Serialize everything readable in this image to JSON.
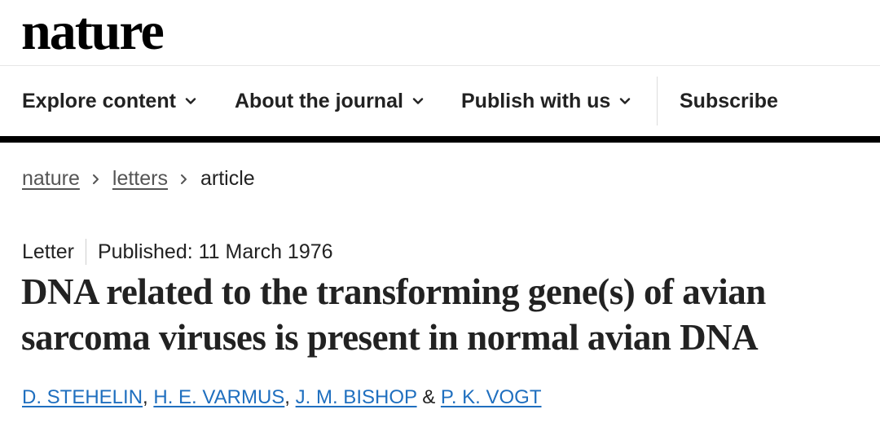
{
  "header": {
    "logo_text": "nature"
  },
  "nav": {
    "items": [
      {
        "label": "Explore content",
        "icon": "chevron-down-icon"
      },
      {
        "label": "About the journal",
        "icon": "chevron-down-icon"
      },
      {
        "label": "Publish with us",
        "icon": "chevron-down-icon"
      },
      {
        "label": "Subscribe"
      }
    ]
  },
  "breadcrumb": {
    "items": [
      "nature",
      "letters",
      "article"
    ],
    "separator_icon": "chevron-right-icon"
  },
  "article": {
    "type": "Letter",
    "published": "Published: 11 March 1976",
    "title": "DNA related to the transforming gene(s) of avian sarcoma viruses is present in normal avian DNA",
    "authors": [
      "D. STEHELIN",
      "H. E. VARMUS",
      "J. M. BISHOP",
      "P. K. VOGT"
    ],
    "author_sep_comma": ", ",
    "author_sep_amp": " & "
  },
  "colors": {
    "link": "#1f6fbf",
    "text": "#222222",
    "nav_border": "#000000"
  }
}
